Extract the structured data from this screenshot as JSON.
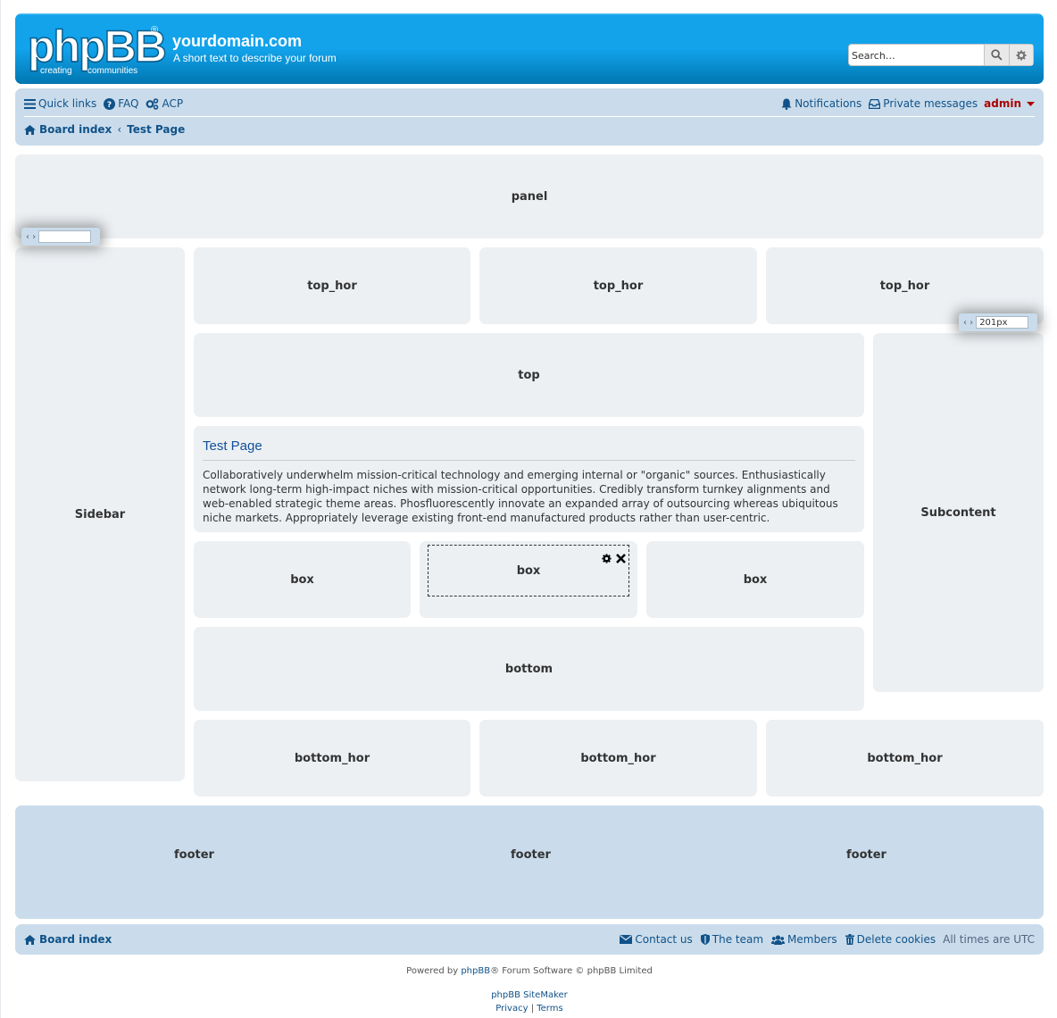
{
  "header": {
    "logo_text": "phpBB",
    "logo_tag_left": "creating",
    "logo_tag_right": "communities",
    "site_title": "yourdomain.com",
    "site_description": "A short text to describe your forum",
    "search_placeholder": "Search…"
  },
  "navbar": {
    "quick_links": "Quick links",
    "faq": "FAQ",
    "acp": "ACP",
    "notifications": "Notifications",
    "private_messages": "Private messages",
    "username": "admin"
  },
  "breadcrumb": {
    "board_index": "Board index",
    "current": "Test Page"
  },
  "blocks": {
    "panel": "panel",
    "sidebar": "Sidebar",
    "top_hor": [
      "top_hor",
      "top_hor",
      "top_hor"
    ],
    "top": "top",
    "subcontent": "Subcontent",
    "box": [
      "box",
      "box",
      "box"
    ],
    "bottom": "bottom",
    "bottom_hor": [
      "bottom_hor",
      "bottom_hor",
      "bottom_hor"
    ],
    "footer": [
      "footer",
      "footer",
      "footer"
    ]
  },
  "resizers": {
    "left_value": "",
    "right_value": "201px"
  },
  "content": {
    "title": "Test Page",
    "body": "Collaboratively underwhelm mission-critical technology and emerging internal or \"organic\" sources. Enthusiastically network long-term high-impact niches with mission-critical opportunities. Credibly transform turnkey alignments and web-enabled strategic theme areas. Phosfluorescently innovate an expanded array of outsourcing whereas ubiquitous niche markets. Appropriately leverage existing front-end manufactured products rather than user-centric."
  },
  "footer_nav": {
    "board_index": "Board index",
    "contact_us": "Contact us",
    "the_team": "The team",
    "members": "Members",
    "delete_cookies": "Delete cookies",
    "timezone": "All times are UTC"
  },
  "copyright": {
    "powered_by": "Powered by",
    "phpbb_link": "phpBB",
    "powered_rest": "® Forum Software © phpBB Limited",
    "sitemaker": "phpBB SiteMaker",
    "privacy": "Privacy",
    "separator": "|",
    "terms": "Terms"
  },
  "colors": {
    "header_gradient_top": "#12a3eb",
    "header_gradient_bottom": "#0076b1",
    "navbar_bg": "#cadceb",
    "block_bg": "#ecf0f3",
    "link": "#105289",
    "username": "#aa0000"
  }
}
